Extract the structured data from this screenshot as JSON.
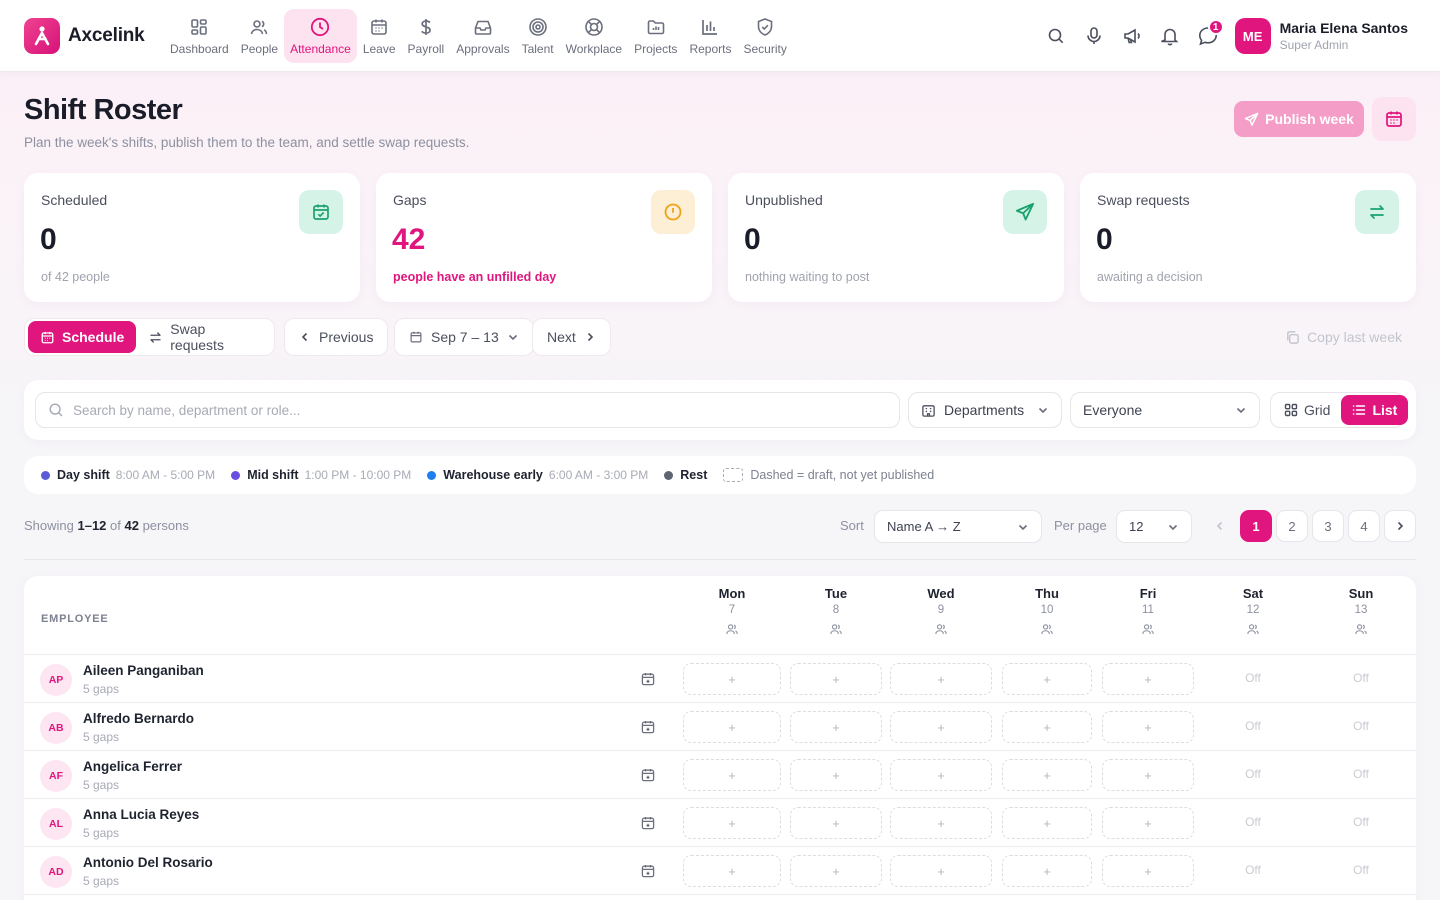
{
  "app": {
    "name": "Axcelink"
  },
  "nav": {
    "items": [
      {
        "label": "Dashboard",
        "icon": "dashboard-icon"
      },
      {
        "label": "People",
        "icon": "people-icon"
      },
      {
        "label": "Attendance",
        "icon": "clock-icon",
        "active": true
      },
      {
        "label": "Leave",
        "icon": "calendar-icon"
      },
      {
        "label": "Payroll",
        "icon": "dollar-icon"
      },
      {
        "label": "Approvals",
        "icon": "inbox-icon"
      },
      {
        "label": "Talent",
        "icon": "target-icon"
      },
      {
        "label": "Workplace",
        "icon": "lifebuoy-icon"
      },
      {
        "label": "Projects",
        "icon": "folder-icon"
      },
      {
        "label": "Reports",
        "icon": "bar-chart-icon"
      },
      {
        "label": "Security",
        "icon": "shield-icon"
      }
    ]
  },
  "toolbar": {
    "notification_count": "1"
  },
  "user": {
    "initials": "ME",
    "name": "Maria Elena Santos",
    "role": "Super Admin"
  },
  "header": {
    "title": "Shift Roster",
    "subtitle": "Plan the week's shifts, publish them to the team, and settle swap requests.",
    "publish_label": "Publish week"
  },
  "stats": [
    {
      "label": "Scheduled",
      "value": "0",
      "note": "of 42 people",
      "icon": "calendar-check-icon"
    },
    {
      "label": "Gaps",
      "value": "42",
      "note": "people have an unfilled day",
      "icon": "alert-circle-icon"
    },
    {
      "label": "Unpublished",
      "value": "0",
      "note": "nothing waiting to post",
      "icon": "send-icon"
    },
    {
      "label": "Swap requests",
      "value": "0",
      "note": "awaiting a decision",
      "icon": "swap-icon"
    }
  ],
  "tabs": {
    "schedule": "Schedule",
    "swaps": "Swap requests"
  },
  "week_nav": {
    "previous": "Previous",
    "range": "Sep 7 – 13",
    "next": "Next",
    "copy": "Copy last week"
  },
  "filters": {
    "search_placeholder": "Search by name, department or role...",
    "department": "Departments",
    "scope": "Everyone",
    "view_grid": "Grid",
    "view_list": "List"
  },
  "legend": [
    {
      "name": "Day shift",
      "time": "8:00 AM - 5:00 PM",
      "color": "#5b5bd6"
    },
    {
      "name": "Mid shift",
      "time": "1:00 PM - 10:00 PM",
      "color": "#6b4fe0"
    },
    {
      "name": "Warehouse early",
      "time": "6:00 AM - 3:00 PM",
      "color": "#1d7ef0"
    },
    {
      "name": "Rest",
      "time": "",
      "color": "#5f6472"
    }
  ],
  "legend_note": "Dashed = draft, not yet published",
  "paging": {
    "showing_prefix": "Showing ",
    "range": "1–12",
    "of": " of ",
    "total": "42",
    "suffix": " persons",
    "sort_label": "Sort",
    "sort_value": "Name A → Z",
    "per_page_label": "Per page",
    "per_page_value": "12",
    "pages": [
      "1",
      "2",
      "3",
      "4"
    ],
    "current_page": "1"
  },
  "roster": {
    "employee_header": "EMPLOYEE",
    "days": [
      {
        "name": "Mon",
        "date": "7"
      },
      {
        "name": "Tue",
        "date": "8"
      },
      {
        "name": "Wed",
        "date": "9"
      },
      {
        "name": "Thu",
        "date": "10"
      },
      {
        "name": "Fri",
        "date": "11"
      },
      {
        "name": "Sat",
        "date": "12"
      },
      {
        "name": "Sun",
        "date": "13"
      }
    ],
    "add_symbol": "+",
    "off_label": "Off",
    "rows": [
      {
        "initials": "AP",
        "name": "Aileen Panganiban",
        "gaps": "5 gaps"
      },
      {
        "initials": "AB",
        "name": "Alfredo Bernardo",
        "gaps": "5 gaps"
      },
      {
        "initials": "AF",
        "name": "Angelica Ferrer",
        "gaps": "5 gaps"
      },
      {
        "initials": "AL",
        "name": "Anna Lucia Reyes",
        "gaps": "5 gaps"
      },
      {
        "initials": "AD",
        "name": "Antonio Del Rosario",
        "gaps": "5 gaps"
      }
    ]
  },
  "colors": {
    "accent": "#e0157e",
    "accent_soft": "#fde3ef",
    "green": "#1aa36f",
    "amber": "#f0a21a"
  }
}
